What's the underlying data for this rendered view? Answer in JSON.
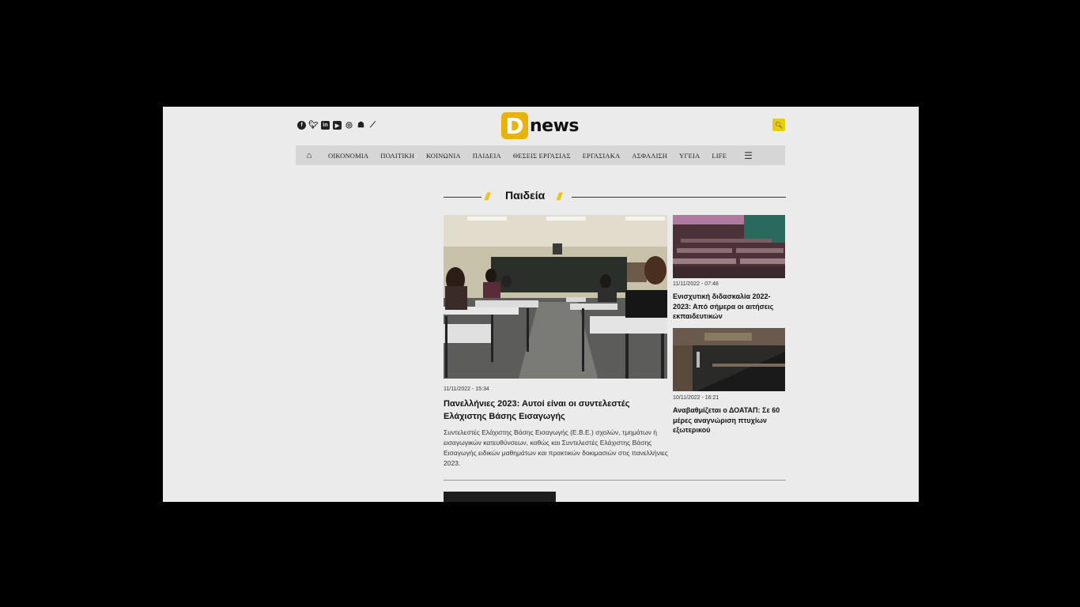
{
  "site": {
    "logo_letter": "D",
    "logo_word": "news",
    "brand_color": "#e8b400",
    "social_icons": [
      "facebook-icon",
      "twitter-icon",
      "linkedin-icon",
      "youtube-icon",
      "instagram-icon",
      "podcast-icon",
      "rss-icon"
    ],
    "search_icon": "search-icon"
  },
  "nav": {
    "home_icon": "home-icon",
    "items": [
      "ΟΙΚΟΝΟΜΙΑ",
      "ΠΟΛΙΤΙΚΗ",
      "ΚΟΙΝΩΝΙΑ",
      "ΠΑΙΔΕΙΑ",
      "ΘΕΣΕΙΣ ΕΡΓΑΣΙΑΣ",
      "ΕΡΓΑΣΙΑΚΑ",
      "ΑΣΦΑΛΙΣΗ",
      "ΥΓΕΙΑ",
      "LIFE"
    ],
    "menu_icon": "hamburger-menu-icon"
  },
  "section": {
    "title": "Παιδεία"
  },
  "main_article": {
    "date": "11/11/2022 - 15:34",
    "title": "Πανελλήνιες 2023: Αυτοί είναι οι συντελεστές Ελάχιστης Βάσης Εισαγωγής",
    "excerpt": "Συντελεστές Ελάχιστης Βάσης Εισαγωγής (Ε.Β.Ε.) σχολών, τμημάτων ή εισαγωγικών κατευθύνσεων, καθώς και Συντελεστές Ελάχιστης Βάσης Εισαγωγής ειδικών μαθημάτων και πρακτικών δοκιμασιών στις πανελλήνιες 2023."
  },
  "side_articles": [
    {
      "date": "11/11/2022 - 07:48",
      "title": "Ενισχυτική διδασκαλία 2022-2023: Από σήμερα οι αιτήσεις εκπαιδευτικών"
    },
    {
      "date": "10/11/2022 - 16:21",
      "title": "Αναβαθμίζεται ο ΔΟΑΤΑΠ: Σε 60 μέρες αναγνώριση πτυχίων εξωτερικού"
    }
  ]
}
